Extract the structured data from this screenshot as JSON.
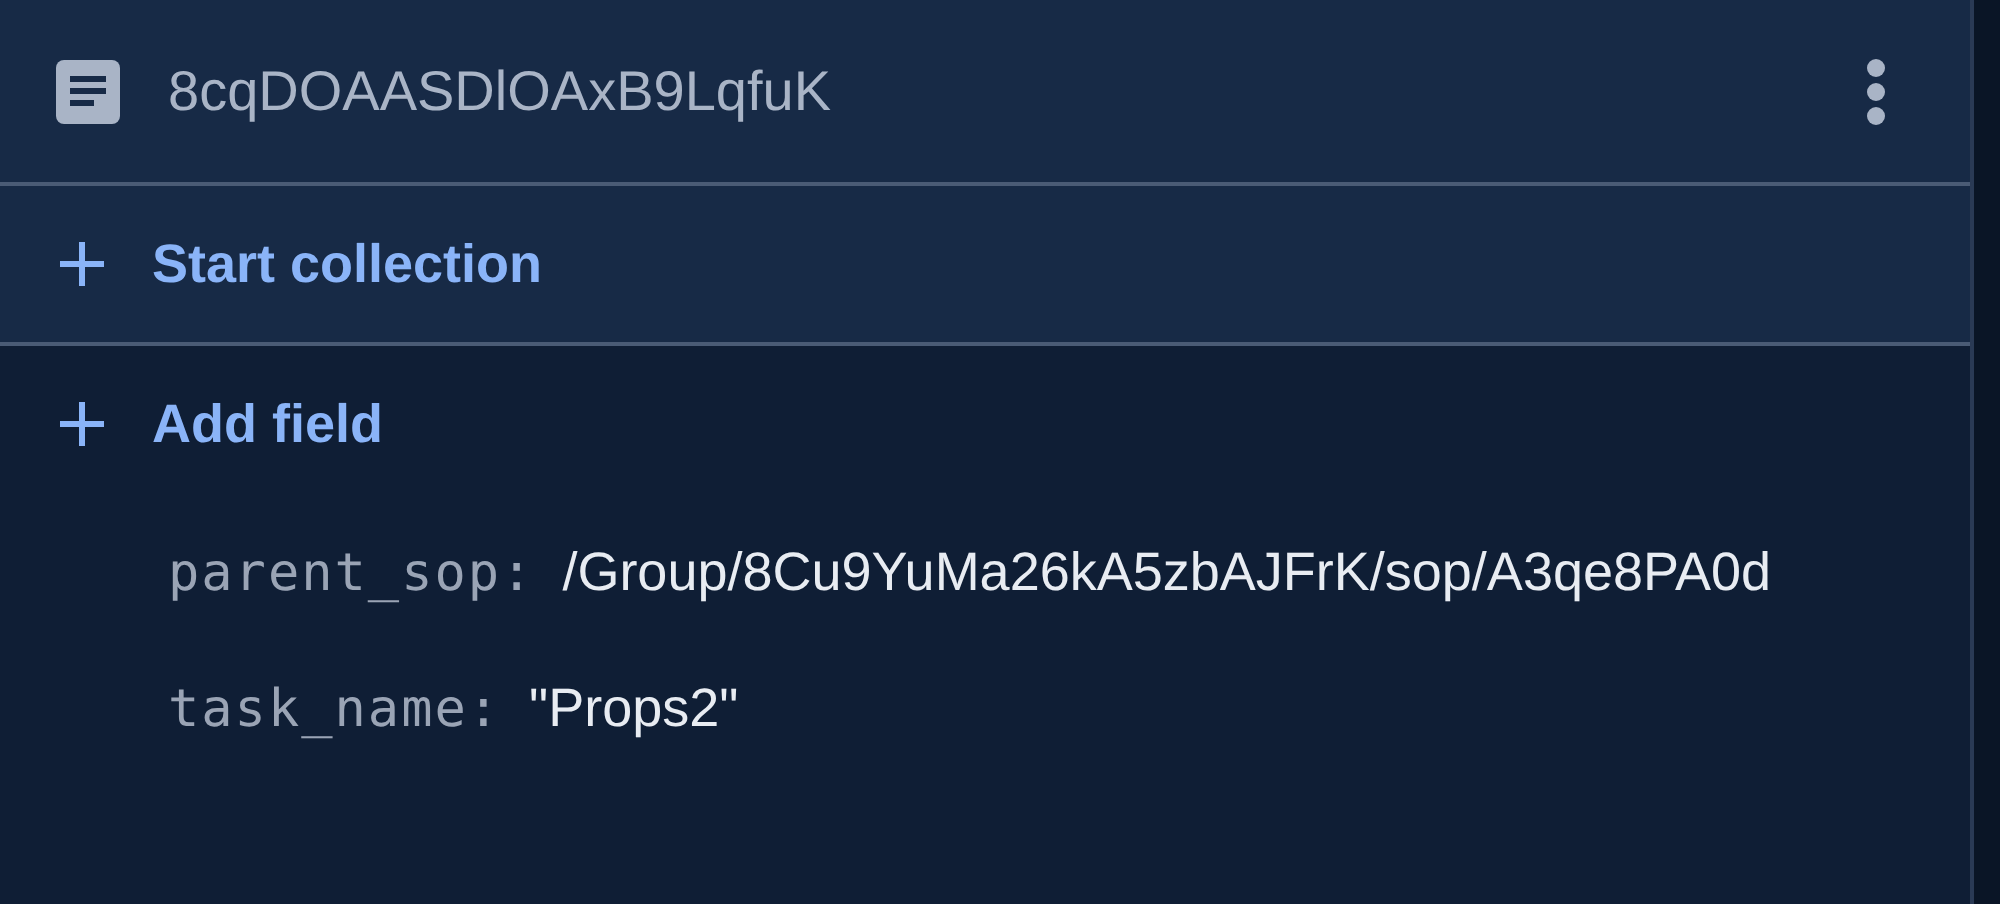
{
  "document": {
    "title": "8cqDOAASDlOAxB9LqfuK"
  },
  "actions": [
    {
      "kind": "collection",
      "label": "Start collection"
    },
    {
      "kind": "field",
      "label": "Add field"
    }
  ],
  "fields": [
    {
      "key": "parent_sop:",
      "value": "/Group/8Cu9YuMa26kA5zbAJFrK/sop/A3qe8PA0d"
    },
    {
      "key": "task_name:",
      "value": "\"Props2\""
    }
  ]
}
